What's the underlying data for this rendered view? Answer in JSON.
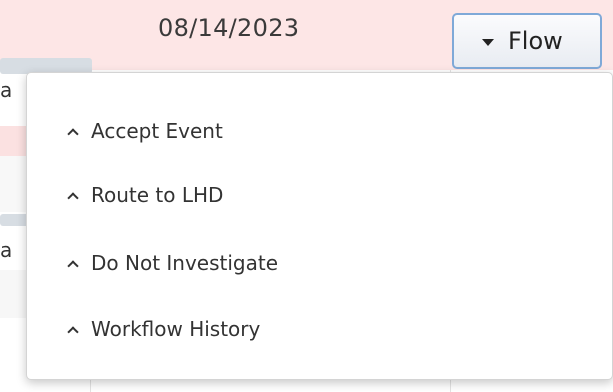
{
  "table": {
    "date_value": "08/14/2023",
    "partial_cells": [
      "a",
      "a"
    ]
  },
  "flow_button": {
    "label": "Flow",
    "caret_icon": "caret-down-icon"
  },
  "dropdown": {
    "item_icon": "chevron-up-icon",
    "items": [
      {
        "label": "Accept Event"
      },
      {
        "label": "Route to LHD"
      },
      {
        "label": "Do Not Investigate"
      },
      {
        "label": "Workflow History"
      }
    ]
  },
  "colors": {
    "header_row_bg": "#fde6e6",
    "highlight_row_bg": "#fbe1e1",
    "button_border": "#7fa9d8",
    "text": "#333333"
  }
}
